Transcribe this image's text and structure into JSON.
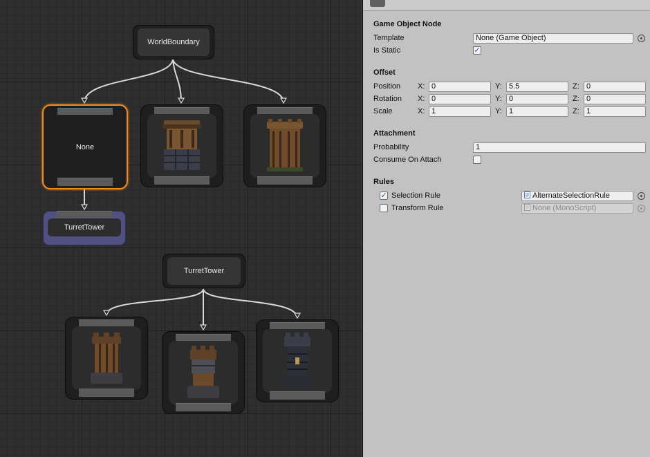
{
  "graph": {
    "world_boundary_label": "WorldBoundary",
    "none_node_label": "None",
    "turret_tower_child_label": "TurretTower",
    "turret_tower_root_label": "TurretTower",
    "colors": {
      "selected_outline": "#f08a1d",
      "purple_node": "#505082",
      "wire": "#d9d9d9"
    },
    "thumbnails": [
      "wooden-tower-stone-base",
      "wooden-tower",
      "wood-turret",
      "wood-stone-turret",
      "stone-turret"
    ]
  },
  "inspector": {
    "game_object_node": {
      "title": "Game Object Node",
      "template_label": "Template",
      "template_value": "None (Game Object)",
      "is_static_label": "Is Static",
      "is_static_checked": true
    },
    "offset": {
      "title": "Offset",
      "rows": [
        {
          "label": "Position",
          "x_label": "X:",
          "x": "0",
          "y_label": "Y:",
          "y": "5.5",
          "z_label": "Z:",
          "z": "0"
        },
        {
          "label": "Rotation",
          "x_label": "X:",
          "x": "0",
          "y_label": "Y:",
          "y": "0",
          "z_label": "Z:",
          "z": "0"
        },
        {
          "label": "Scale",
          "x_label": "X:",
          "x": "1",
          "y_label": "Y:",
          "y": "1",
          "z_label": "Z:",
          "z": "1"
        }
      ]
    },
    "attachment": {
      "title": "Attachment",
      "probability_label": "Probability",
      "probability_value": "1",
      "consume_label": "Consume On Attach",
      "consume_checked": false
    },
    "rules": {
      "title": "Rules",
      "selection_label": "Selection Rule",
      "selection_checked": true,
      "selection_value": "AlternateSelectionRule",
      "transform_label": "Transform Rule",
      "transform_checked": false,
      "transform_value": "None (MonoScript)"
    }
  }
}
